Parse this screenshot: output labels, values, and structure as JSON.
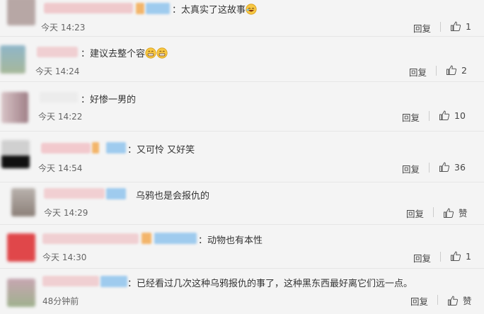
{
  "icons": {
    "thumbs_up": "thumbs-up-icon",
    "laugh_emoji": "laughing-emoji-icon",
    "grin_emoji": "grinning-emoji-icon"
  },
  "reply_label": "回复",
  "comments": [
    {
      "text": "：太真实了这故事",
      "time": "今天 14:23",
      "likes": "1"
    },
    {
      "text": "：建议去整个容",
      "time": "今天 14:24",
      "likes": "2"
    },
    {
      "text": "：好惨一男的",
      "time": "今天 14:22",
      "likes": "10"
    },
    {
      "text": "：又可怜 又好笑",
      "time": "今天 14:54",
      "likes": "36"
    },
    {
      "text": "乌鸦也是会报仇的",
      "time": "今天 14:29",
      "likes": "赞"
    },
    {
      "text": "：动物也有本性",
      "time": "今天 14:30",
      "likes": "1"
    },
    {
      "text": "：已经看过几次这种乌鸦报仇的事了，这种黑东西最好离它们远一点。",
      "time": "48分钟前",
      "likes": "赞"
    }
  ]
}
